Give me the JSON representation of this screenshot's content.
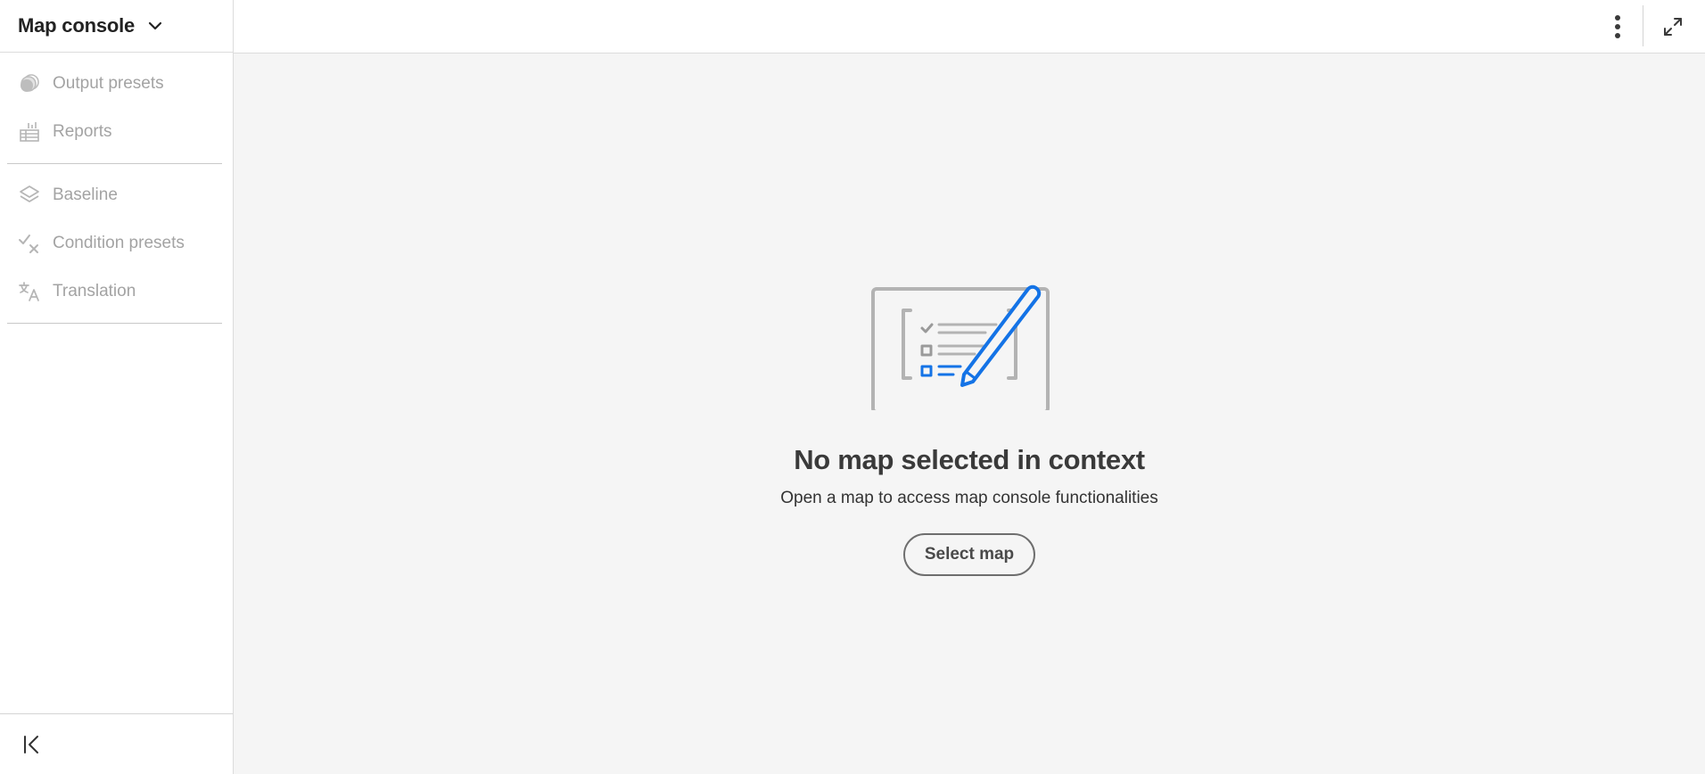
{
  "sidebar": {
    "title": "Map console",
    "title_icon": "chevron-down-icon",
    "groups": [
      {
        "items": [
          {
            "label": "Output presets",
            "icon": "output-presets-icon"
          },
          {
            "label": "Reports",
            "icon": "reports-icon"
          }
        ]
      },
      {
        "items": [
          {
            "label": "Baseline",
            "icon": "layers-icon"
          },
          {
            "label": "Condition presets",
            "icon": "condition-icon"
          },
          {
            "label": "Translation",
            "icon": "translate-icon"
          }
        ]
      }
    ],
    "collapse_icon": "collapse-left-icon"
  },
  "topbar": {
    "more_icon": "more-vertical-icon",
    "expand_icon": "expand-icon"
  },
  "empty_state": {
    "illustration": "checklist-pen-illustration",
    "title": "No map selected in context",
    "description": "Open a map to access map console functionalities",
    "button_label": "Select map"
  },
  "colors": {
    "accent": "#1473e6",
    "muted_text": "#a3a3a3",
    "illustration_gray": "#b3b3b3"
  }
}
